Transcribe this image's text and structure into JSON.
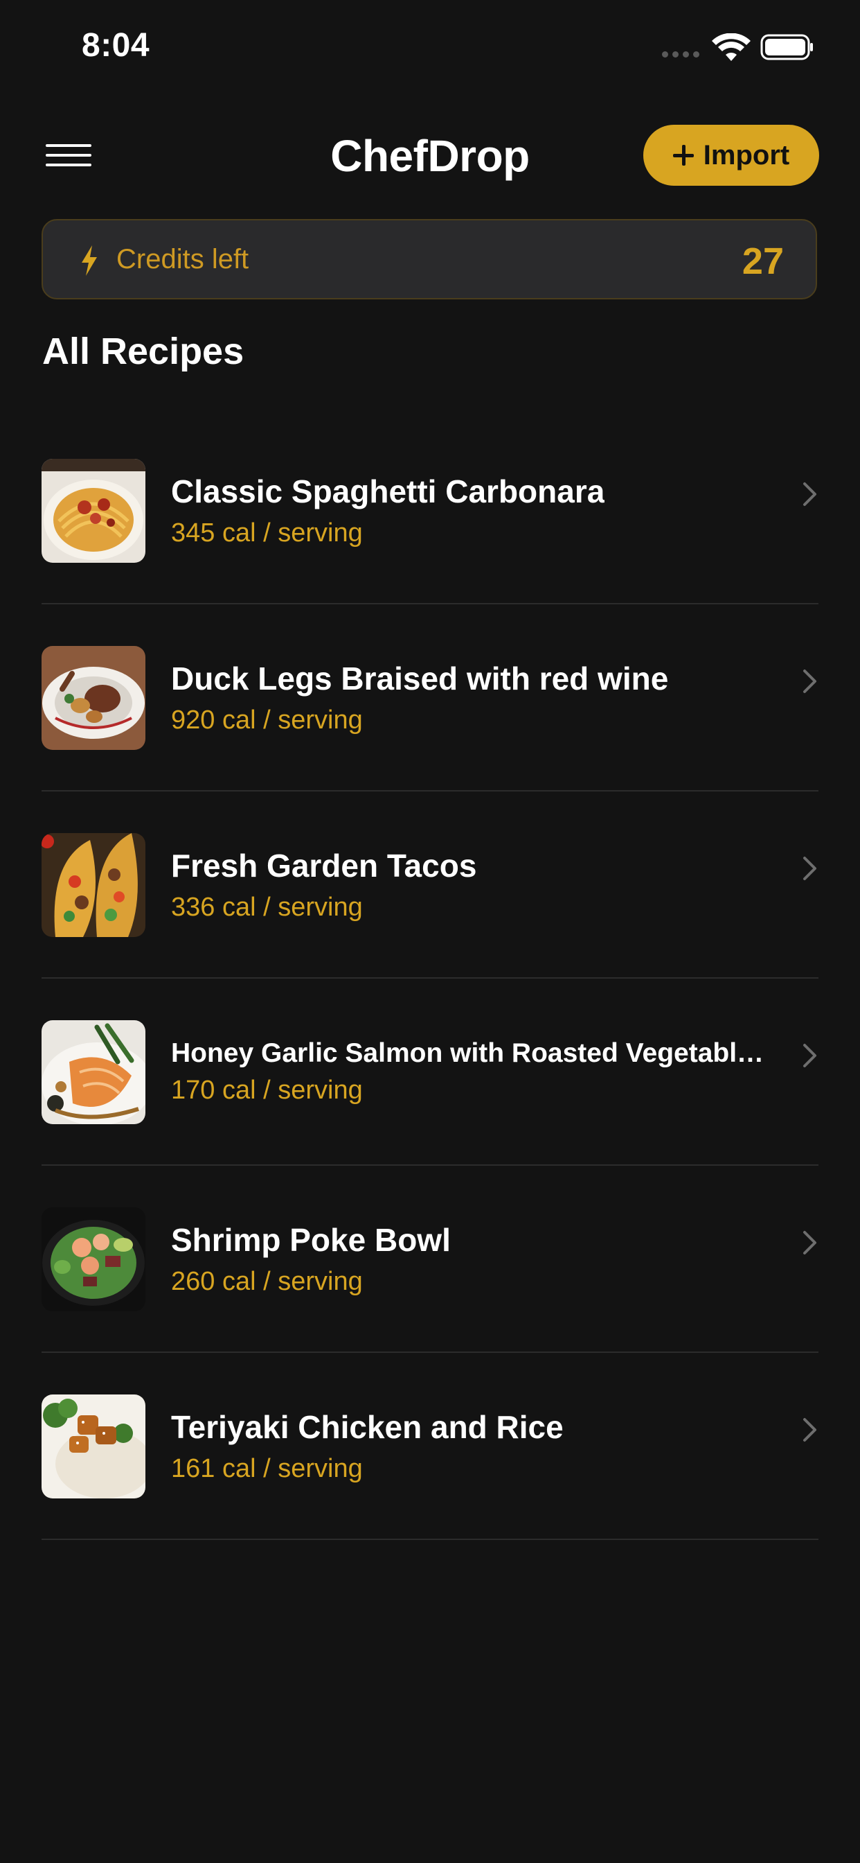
{
  "status_bar": {
    "time": "8:04"
  },
  "nav": {
    "title": "ChefDrop",
    "import_label": "Import"
  },
  "credits": {
    "label": "Credits left",
    "count": "27"
  },
  "section_title": "All Recipes",
  "recipes": [
    {
      "name": "Classic Spaghetti Carbonara",
      "calories": "345 cal / serving"
    },
    {
      "name": "Duck Legs Braised with red wine",
      "calories": "920 cal / serving"
    },
    {
      "name": "Fresh Garden Tacos",
      "calories": "336 cal / serving"
    },
    {
      "name": "Honey Garlic Salmon with Roasted Vegetable…",
      "calories": "170 cal / serving"
    },
    {
      "name": "Shrimp Poke Bowl",
      "calories": "260 cal / serving"
    },
    {
      "name": "Teriyaki Chicken and Rice",
      "calories": "161 cal / serving"
    }
  ],
  "colors": {
    "background": "#131313",
    "accent": "#d8a521",
    "card": "#2a2a2c",
    "divider": "#2c2c2c"
  },
  "icons": {
    "menu": "hamburger-menu-icon",
    "import": "plus-icon",
    "credits": "lightning-bolt-icon",
    "row": "chevron-right-icon"
  }
}
